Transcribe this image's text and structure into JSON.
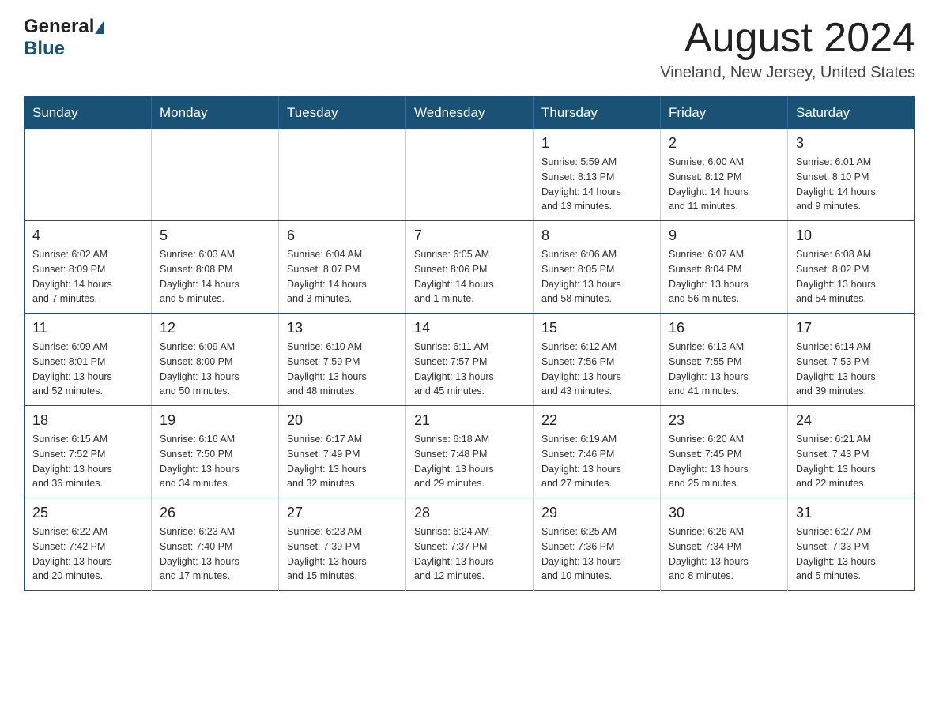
{
  "header": {
    "logo_general": "General",
    "logo_blue": "Blue",
    "month_title": "August 2024",
    "location": "Vineland, New Jersey, United States"
  },
  "weekdays": [
    "Sunday",
    "Monday",
    "Tuesday",
    "Wednesday",
    "Thursday",
    "Friday",
    "Saturday"
  ],
  "weeks": [
    [
      {
        "day": "",
        "info": ""
      },
      {
        "day": "",
        "info": ""
      },
      {
        "day": "",
        "info": ""
      },
      {
        "day": "",
        "info": ""
      },
      {
        "day": "1",
        "info": "Sunrise: 5:59 AM\nSunset: 8:13 PM\nDaylight: 14 hours\nand 13 minutes."
      },
      {
        "day": "2",
        "info": "Sunrise: 6:00 AM\nSunset: 8:12 PM\nDaylight: 14 hours\nand 11 minutes."
      },
      {
        "day": "3",
        "info": "Sunrise: 6:01 AM\nSunset: 8:10 PM\nDaylight: 14 hours\nand 9 minutes."
      }
    ],
    [
      {
        "day": "4",
        "info": "Sunrise: 6:02 AM\nSunset: 8:09 PM\nDaylight: 14 hours\nand 7 minutes."
      },
      {
        "day": "5",
        "info": "Sunrise: 6:03 AM\nSunset: 8:08 PM\nDaylight: 14 hours\nand 5 minutes."
      },
      {
        "day": "6",
        "info": "Sunrise: 6:04 AM\nSunset: 8:07 PM\nDaylight: 14 hours\nand 3 minutes."
      },
      {
        "day": "7",
        "info": "Sunrise: 6:05 AM\nSunset: 8:06 PM\nDaylight: 14 hours\nand 1 minute."
      },
      {
        "day": "8",
        "info": "Sunrise: 6:06 AM\nSunset: 8:05 PM\nDaylight: 13 hours\nand 58 minutes."
      },
      {
        "day": "9",
        "info": "Sunrise: 6:07 AM\nSunset: 8:04 PM\nDaylight: 13 hours\nand 56 minutes."
      },
      {
        "day": "10",
        "info": "Sunrise: 6:08 AM\nSunset: 8:02 PM\nDaylight: 13 hours\nand 54 minutes."
      }
    ],
    [
      {
        "day": "11",
        "info": "Sunrise: 6:09 AM\nSunset: 8:01 PM\nDaylight: 13 hours\nand 52 minutes."
      },
      {
        "day": "12",
        "info": "Sunrise: 6:09 AM\nSunset: 8:00 PM\nDaylight: 13 hours\nand 50 minutes."
      },
      {
        "day": "13",
        "info": "Sunrise: 6:10 AM\nSunset: 7:59 PM\nDaylight: 13 hours\nand 48 minutes."
      },
      {
        "day": "14",
        "info": "Sunrise: 6:11 AM\nSunset: 7:57 PM\nDaylight: 13 hours\nand 45 minutes."
      },
      {
        "day": "15",
        "info": "Sunrise: 6:12 AM\nSunset: 7:56 PM\nDaylight: 13 hours\nand 43 minutes."
      },
      {
        "day": "16",
        "info": "Sunrise: 6:13 AM\nSunset: 7:55 PM\nDaylight: 13 hours\nand 41 minutes."
      },
      {
        "day": "17",
        "info": "Sunrise: 6:14 AM\nSunset: 7:53 PM\nDaylight: 13 hours\nand 39 minutes."
      }
    ],
    [
      {
        "day": "18",
        "info": "Sunrise: 6:15 AM\nSunset: 7:52 PM\nDaylight: 13 hours\nand 36 minutes."
      },
      {
        "day": "19",
        "info": "Sunrise: 6:16 AM\nSunset: 7:50 PM\nDaylight: 13 hours\nand 34 minutes."
      },
      {
        "day": "20",
        "info": "Sunrise: 6:17 AM\nSunset: 7:49 PM\nDaylight: 13 hours\nand 32 minutes."
      },
      {
        "day": "21",
        "info": "Sunrise: 6:18 AM\nSunset: 7:48 PM\nDaylight: 13 hours\nand 29 minutes."
      },
      {
        "day": "22",
        "info": "Sunrise: 6:19 AM\nSunset: 7:46 PM\nDaylight: 13 hours\nand 27 minutes."
      },
      {
        "day": "23",
        "info": "Sunrise: 6:20 AM\nSunset: 7:45 PM\nDaylight: 13 hours\nand 25 minutes."
      },
      {
        "day": "24",
        "info": "Sunrise: 6:21 AM\nSunset: 7:43 PM\nDaylight: 13 hours\nand 22 minutes."
      }
    ],
    [
      {
        "day": "25",
        "info": "Sunrise: 6:22 AM\nSunset: 7:42 PM\nDaylight: 13 hours\nand 20 minutes."
      },
      {
        "day": "26",
        "info": "Sunrise: 6:23 AM\nSunset: 7:40 PM\nDaylight: 13 hours\nand 17 minutes."
      },
      {
        "day": "27",
        "info": "Sunrise: 6:23 AM\nSunset: 7:39 PM\nDaylight: 13 hours\nand 15 minutes."
      },
      {
        "day": "28",
        "info": "Sunrise: 6:24 AM\nSunset: 7:37 PM\nDaylight: 13 hours\nand 12 minutes."
      },
      {
        "day": "29",
        "info": "Sunrise: 6:25 AM\nSunset: 7:36 PM\nDaylight: 13 hours\nand 10 minutes."
      },
      {
        "day": "30",
        "info": "Sunrise: 6:26 AM\nSunset: 7:34 PM\nDaylight: 13 hours\nand 8 minutes."
      },
      {
        "day": "31",
        "info": "Sunrise: 6:27 AM\nSunset: 7:33 PM\nDaylight: 13 hours\nand 5 minutes."
      }
    ]
  ]
}
